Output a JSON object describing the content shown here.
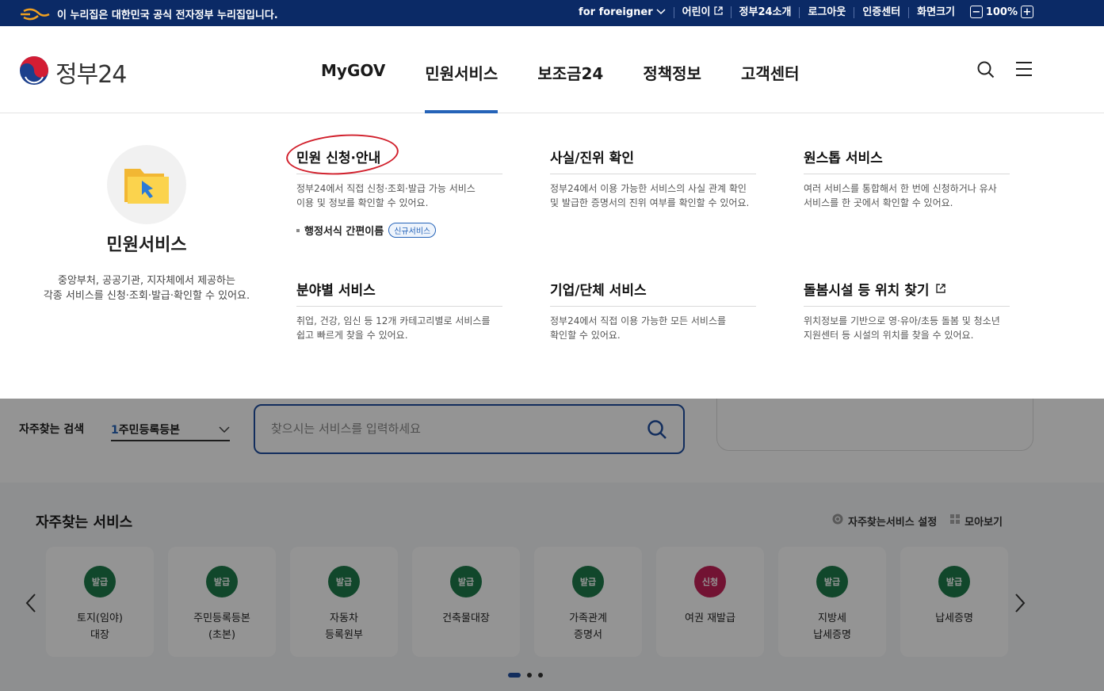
{
  "topbar": {
    "gov_notice": "이 누리집은 대한민국 공식 전자정부 누리집입니다.",
    "links": [
      "for foreigner",
      "어린이",
      "정부24소개",
      "로그아웃",
      "인증센터",
      "화면크기"
    ],
    "zoom_minus": "−",
    "zoom_value": "100%",
    "zoom_plus": "+"
  },
  "header": {
    "logo_text": "정부24",
    "nav": [
      "MyGOV",
      "민원서비스",
      "보조금24",
      "정책정보",
      "고객센터"
    ],
    "active_nav": "민원서비스"
  },
  "mega": {
    "title": "민원서비스",
    "desc_line1": "중앙부처, 공공기관, 지자체에서 제공하는",
    "desc_line2": "각종 서비스를 신청·조회·발급·확인할 수 있어요.",
    "cols": [
      {
        "heading": "민원 신청·안내",
        "desc1": "정부24에서 직접 신청·조회·발급 가능 서비스",
        "desc2": "이용 및 정보를 확인할 수 있어요."
      },
      {
        "heading": "사실/진위 확인",
        "desc1": "정부24에서 이용 가능한 서비스의 사실 관계 확인",
        "desc2": "및 발급한 증명서의 진위 여부를 확인할 수 있어요."
      },
      {
        "heading": "원스톱 서비스",
        "desc1": "여러 서비스를 통합해서 한 번에 신청하거나 유사",
        "desc2": "서비스를 한 곳에서 확인할 수 있어요."
      },
      {
        "heading": "분야별 서비스",
        "desc1": "취업, 건강, 임신 등 12개 카테고리별로 서비스를",
        "desc2": "쉽고 빠르게 찾을 수 있어요."
      },
      {
        "heading": "기업/단체 서비스",
        "desc1": "정부24에서 직접 이용 가능한 모든 서비스를",
        "desc2": "확인할 수 있어요."
      },
      {
        "heading": "돌봄시설 등 위치 찾기",
        "desc1": "위치정보를 기반으로 영·유아/초등 돌봄 및 청소년",
        "desc2": "지원센터 등 시설의 위치를 찾을 수 있어요."
      }
    ],
    "sub_link": "행정서식 간편이름",
    "sub_badge": "신규서비스"
  },
  "search": {
    "freq_label": "자주찾는 검색",
    "freq_num": "1",
    "freq_value": "주민등록등본",
    "placeholder": "찾으시는 서비스를 입력하세요"
  },
  "services": {
    "title": "자주찾는 서비스",
    "settings": "자주찾는서비스 설정",
    "gather": "모아보기",
    "items": [
      {
        "badge": "발급",
        "name": "토지(임야)\n대장"
      },
      {
        "badge": "발급",
        "name": "주민등록등본\n(초본)"
      },
      {
        "badge": "발급",
        "name": "자동차\n등록원부"
      },
      {
        "badge": "발급",
        "name": "건축물대장"
      },
      {
        "badge": "발급",
        "name": "가족관계\n증명서"
      },
      {
        "badge": "신청",
        "name": "여권 재발급"
      },
      {
        "badge": "발급",
        "name": "지방세\n납세증명"
      },
      {
        "badge": "발급",
        "name": "납세증명"
      }
    ]
  }
}
